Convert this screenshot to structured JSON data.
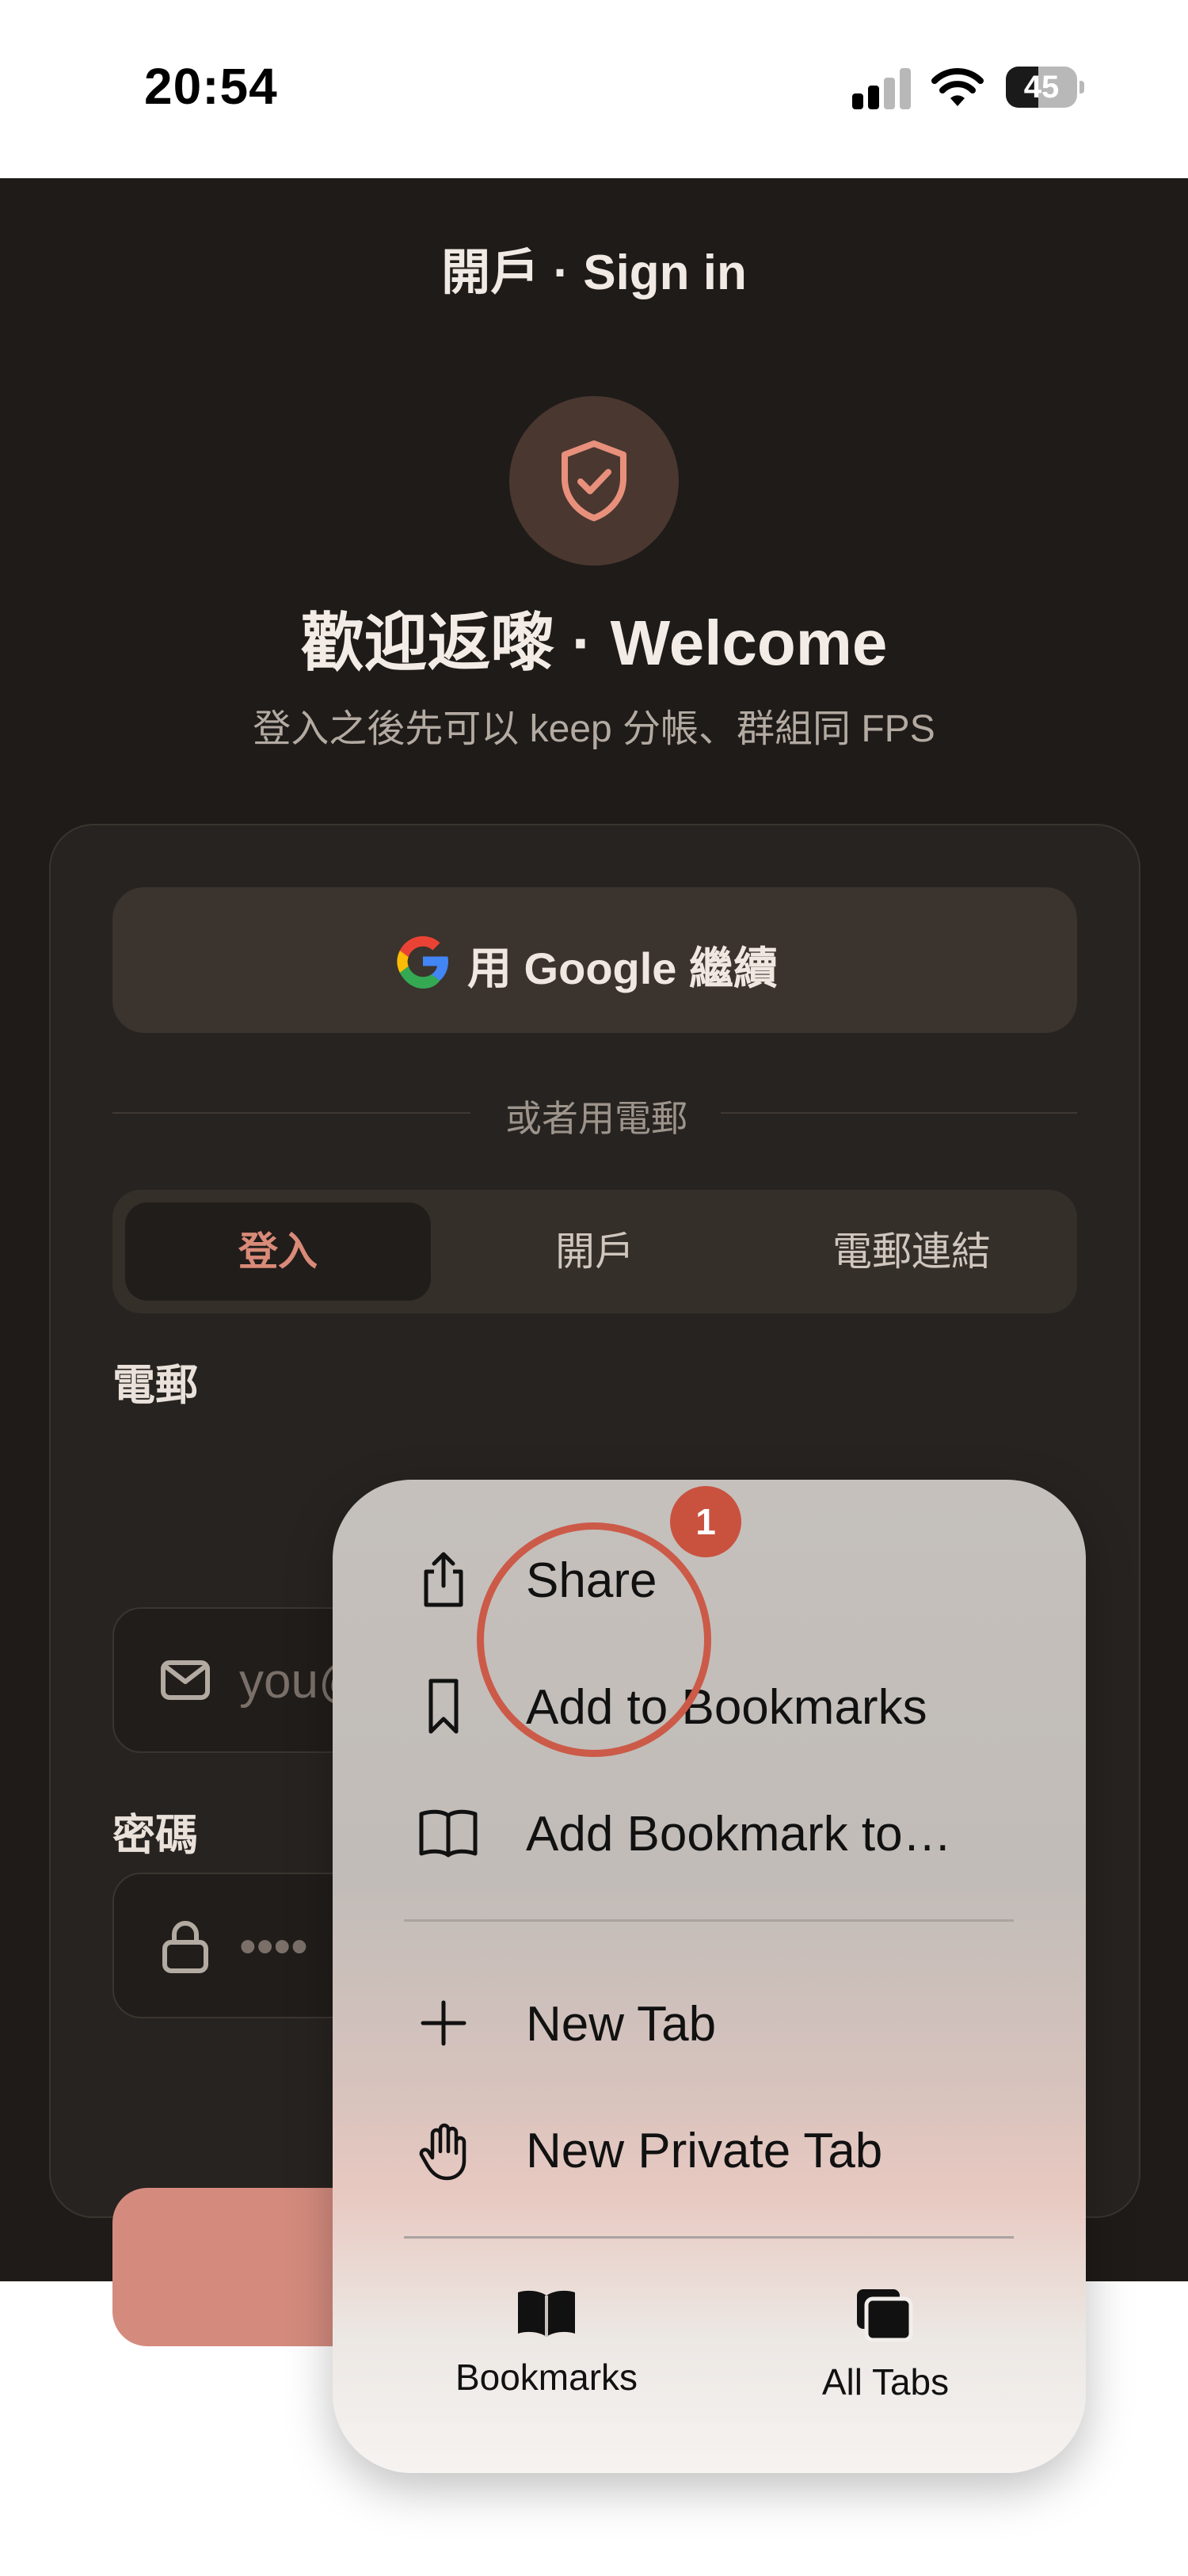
{
  "status_bar": {
    "time": "20:54",
    "battery": "45",
    "battery_level": 0.45
  },
  "header": {
    "title": "開戶 · Sign in"
  },
  "hero": {
    "icon": "shield-check-icon",
    "title": "歡迎返嚟 · Welcome",
    "subtitle": "登入之後先可以 keep 分帳、群組同 FPS"
  },
  "auth_card": {
    "google_button": {
      "icon": "google-icon",
      "label": "用 Google 繼續"
    },
    "divider_text": "或者用電郵",
    "tabs": [
      {
        "label": "登入",
        "active": true
      },
      {
        "label": "開戶",
        "active": false
      },
      {
        "label": "電郵連結",
        "active": false
      }
    ],
    "email": {
      "label": "電郵",
      "icon": "mail-icon",
      "placeholder": "you@"
    },
    "password": {
      "label": "密碼",
      "icon": "lock-icon",
      "placeholder": "••••"
    }
  },
  "context_menu": {
    "items": [
      {
        "icon": "share-icon",
        "label": "Share"
      },
      {
        "icon": "bookmark-icon",
        "label": "Add to Bookmarks"
      },
      {
        "icon": "book-open-icon",
        "label": "Add Bookmark to…"
      },
      {
        "icon": "plus-icon",
        "label": "New Tab"
      },
      {
        "icon": "hand-icon",
        "label": "New Private Tab"
      }
    ],
    "bottom": [
      {
        "icon": "book-icon",
        "label": "Bookmarks"
      },
      {
        "icon": "tabs-icon",
        "label": "All Tabs"
      }
    ]
  },
  "annotation": {
    "badge": "1",
    "color": "#cc5a48"
  },
  "colors": {
    "background": "#1e1b18",
    "accent": "#d98a78",
    "submit": "#d48b7e"
  }
}
